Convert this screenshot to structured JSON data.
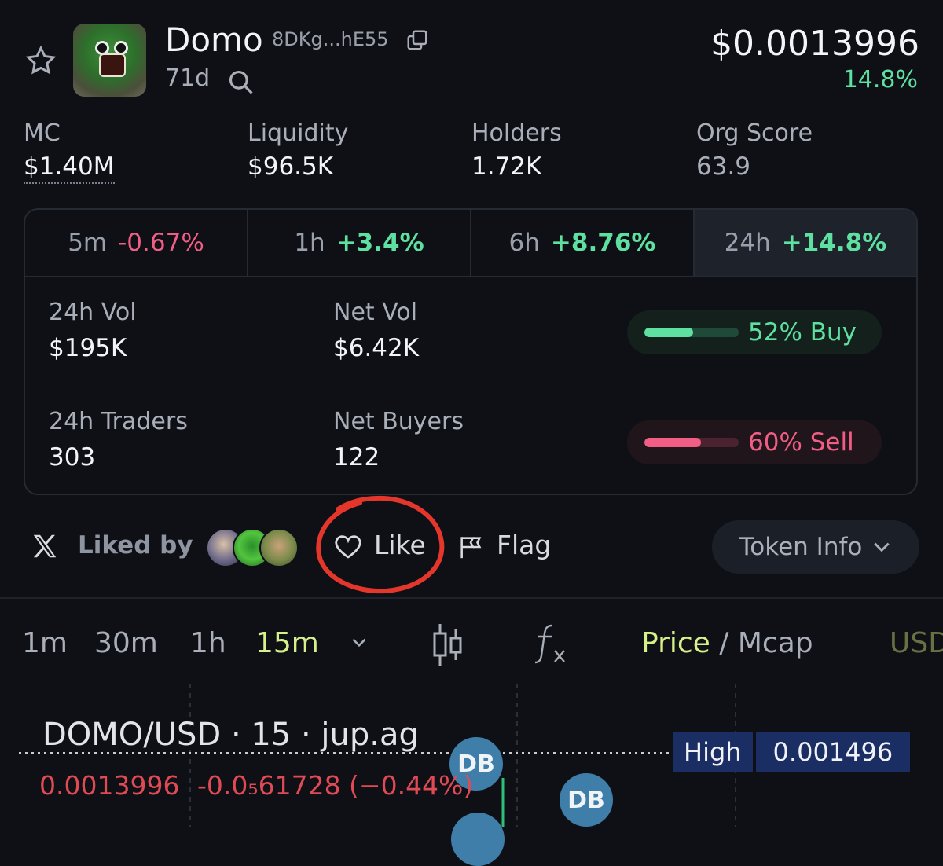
{
  "header": {
    "token_name": "Domo",
    "address": "8DKg...hE55",
    "age": "71d",
    "price": "$0.0013996",
    "price_change": "14.8%",
    "icons": [
      "star-icon",
      "copy-icon",
      "search-icon"
    ]
  },
  "stats": [
    {
      "label": "MC",
      "value": "$1.40M"
    },
    {
      "label": "Liquidity",
      "value": "$96.5K"
    },
    {
      "label": "Holders",
      "value": "1.72K"
    },
    {
      "label": "Org Score",
      "value": "63.9"
    }
  ],
  "periods": [
    {
      "label": "5m",
      "change": "-0.67%"
    },
    {
      "label": "1h",
      "change": "+3.4%"
    },
    {
      "label": "6h",
      "change": "+8.76%"
    },
    {
      "label": "24h",
      "change": "+14.8%"
    }
  ],
  "metrics": {
    "vol_label": "24h Vol",
    "vol_value": "$195K",
    "net_vol_label": "Net Vol",
    "net_vol_value": "$6.42K",
    "traders_label": "24h Traders",
    "traders_value": "303",
    "net_buyers_label": "Net Buyers",
    "net_buyers_value": "122",
    "buy_text": "52% Buy",
    "buy_fraction": 0.52,
    "sell_text": "60% Sell",
    "sell_fraction": 0.6
  },
  "social": {
    "liked_by": "Liked by",
    "like": "Like",
    "flag": "Flag",
    "token_info": "Token Info"
  },
  "toolbar": {
    "timeframes": [
      "1m",
      "30m",
      "1h",
      "15m"
    ],
    "active_timeframe": "15m",
    "price_label": "Price",
    "separator": " / ",
    "mcap_label": "Mcap",
    "currency": "USD"
  },
  "chart": {
    "title": "DOMO/USD · 15 · jup.ag",
    "ohlc_price": "0.0013996",
    "ohlc_change": "-0.0₅61728 (−0.44%)",
    "high_label": "High",
    "high_value": "0.001496",
    "marker_label": "DB"
  },
  "colors": {
    "positive": "#5ee0a0",
    "negative": "#f05d85",
    "accent": "#d6f08a",
    "annotation": "#e5362c"
  }
}
